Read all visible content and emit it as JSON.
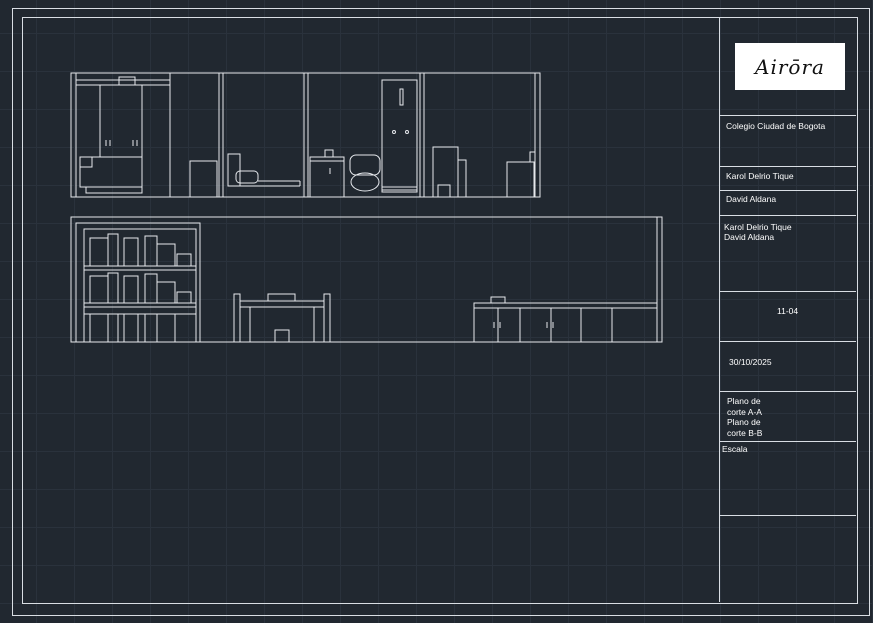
{
  "sheet": {
    "background": "#212830",
    "line_color": "#d9dee4"
  },
  "logo": {
    "text": "Airōra"
  },
  "title_block": {
    "school": "Colegio Ciudad de Bogota",
    "author_1": "Karol Delrio Tique",
    "author_2": "David Aldana",
    "authors_line_1": "Karol Delrio Tique",
    "authors_line_2": "David Aldana",
    "grade": "11-04",
    "date": "30/10/2025",
    "plan_line_1": "Plano de",
    "plan_line_2": "corte A-A",
    "plan_line_3": "Plano de",
    "plan_line_4": "corte B-B",
    "scale_label": "Escala"
  },
  "drawings": {
    "section_a": "corte A-A",
    "section_b": "corte B-B"
  }
}
